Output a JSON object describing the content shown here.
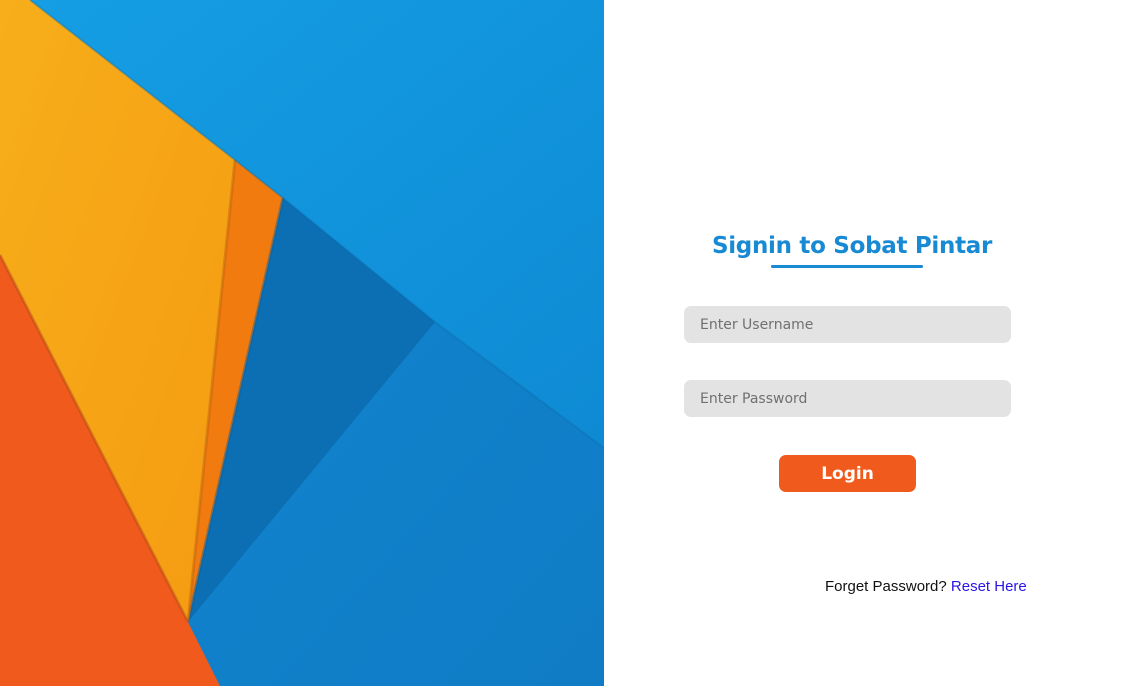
{
  "hero": {
    "colors": {
      "blue_light": "#1299e0",
      "blue_mid": "#0f86cf",
      "blue_dark": "#0c6fb4",
      "yellow": "#f8a817",
      "orange": "#f17b0f",
      "orange_red": "#f05a1c"
    }
  },
  "login": {
    "title": "Signin to Sobat Pintar",
    "username_placeholder": "Enter Username",
    "password_placeholder": "Enter Password",
    "button_label": "Login",
    "forgot_text": "Forget Password?",
    "reset_link": "Reset Here"
  },
  "theme": {
    "accent": "#1889d3",
    "button": "#f05a1c",
    "field_bg": "#e3e3e3",
    "link": "#2a15e6"
  }
}
